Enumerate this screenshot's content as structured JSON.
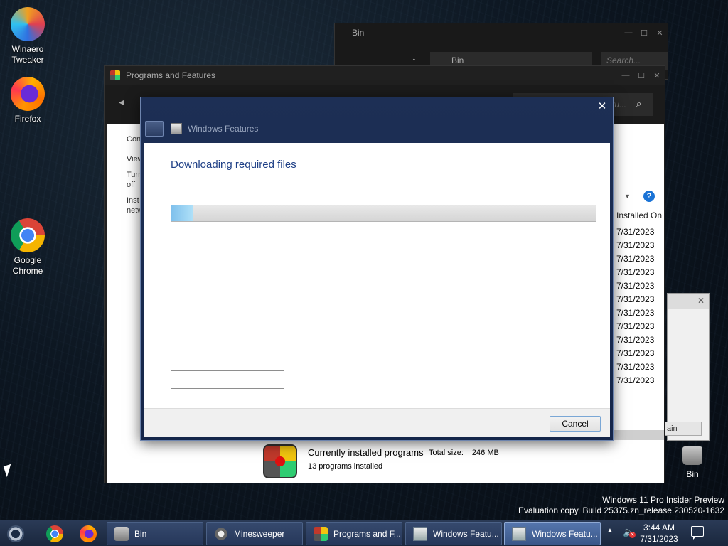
{
  "desktop": {
    "icons": [
      {
        "label": "Winaero Tweaker",
        "icon": "winaero-tweaker-icon"
      },
      {
        "label": "Firefox",
        "icon": "firefox-icon"
      },
      {
        "label": "Google Chrome",
        "icon": "chrome-icon"
      },
      {
        "label": "Bin",
        "icon": "recycle-bin-icon"
      }
    ]
  },
  "bin_window": {
    "title": "Bin",
    "address": "Bin",
    "search_placeholder": "Search..."
  },
  "programs_window": {
    "title": "Programs and Features",
    "search_placeholder": "tu...",
    "side_links": [
      "Con",
      "View",
      "Turn off",
      "Inst netw"
    ],
    "column_header": "Installed On",
    "installed_dates": [
      "7/31/2023",
      "7/31/2023",
      "7/31/2023",
      "7/31/2023",
      "7/31/2023",
      "7/31/2023",
      "7/31/2023",
      "7/31/2023",
      "7/31/2023",
      "7/31/2023",
      "7/31/2023",
      "7/31/2023"
    ],
    "footer": {
      "title": "Currently installed programs",
      "total_size_label": "Total size:",
      "total_size_value": "246 MB",
      "count": "13 programs installed"
    }
  },
  "small_dialog": {
    "button_label": "ain"
  },
  "features_dialog": {
    "title": "Windows Features",
    "heading": "Downloading required files",
    "progress_fraction": 0.05,
    "cancel_label": "Cancel"
  },
  "watermark": {
    "line1": "Windows 11 Pro Insider Preview",
    "line2": "Evaluation copy. Build 25375.zn_release.230520-1632"
  },
  "taskbar": {
    "tasks": [
      {
        "label": "Bin",
        "icon": "recycle-bin-icon"
      },
      {
        "label": "Minesweeper",
        "icon": "minesweeper-icon"
      },
      {
        "label": "Programs and F...",
        "icon": "programs-features-icon"
      },
      {
        "label": "Windows Featu...",
        "icon": "windows-features-icon"
      },
      {
        "label": "Windows Featu...",
        "icon": "windows-features-icon",
        "active": true
      }
    ],
    "clock_time": "3:44 AM",
    "clock_date": "7/31/2023"
  }
}
